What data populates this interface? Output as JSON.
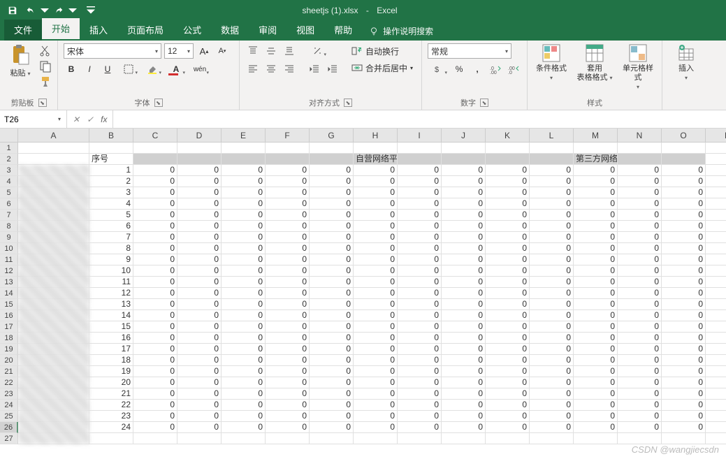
{
  "title": {
    "doc": "sheetjs (1).xlsx",
    "sep": "-",
    "app": "Excel"
  },
  "tabs": {
    "file": "文件",
    "home": "开始",
    "insert": "插入",
    "layout": "页面布局",
    "formulas": "公式",
    "data": "数据",
    "review": "审阅",
    "view": "视图",
    "help": "帮助",
    "tellme": "操作说明搜索"
  },
  "ribbon": {
    "clipboard": {
      "paste": "粘贴",
      "label": "剪贴板"
    },
    "font": {
      "family": "宋体",
      "size": "12",
      "label": "字体"
    },
    "alignment": {
      "wrap": "自动换行",
      "merge": "合并后居中",
      "label": "对齐方式"
    },
    "number": {
      "format": "常规",
      "label": "数字"
    },
    "styles": {
      "cond": "条件格式",
      "table": "套用\n表格格式",
      "cell": "单元格样式",
      "label": "样式"
    },
    "cells": {
      "insert": "插入"
    }
  },
  "formula": {
    "name_box": "T26"
  },
  "grid": {
    "cols": [
      "A",
      "B",
      "C",
      "D",
      "E",
      "F",
      "G",
      "H",
      "I",
      "J",
      "K",
      "L",
      "M",
      "N",
      "O",
      "P"
    ],
    "row2": {
      "b": "序号",
      "h": "自营网络平台渠道",
      "m": "第三方网络平台渠道"
    },
    "num_rows": 24,
    "selected_row": 26,
    "total_rows": 27
  },
  "watermark": "CSDN @wangjiecsdn"
}
